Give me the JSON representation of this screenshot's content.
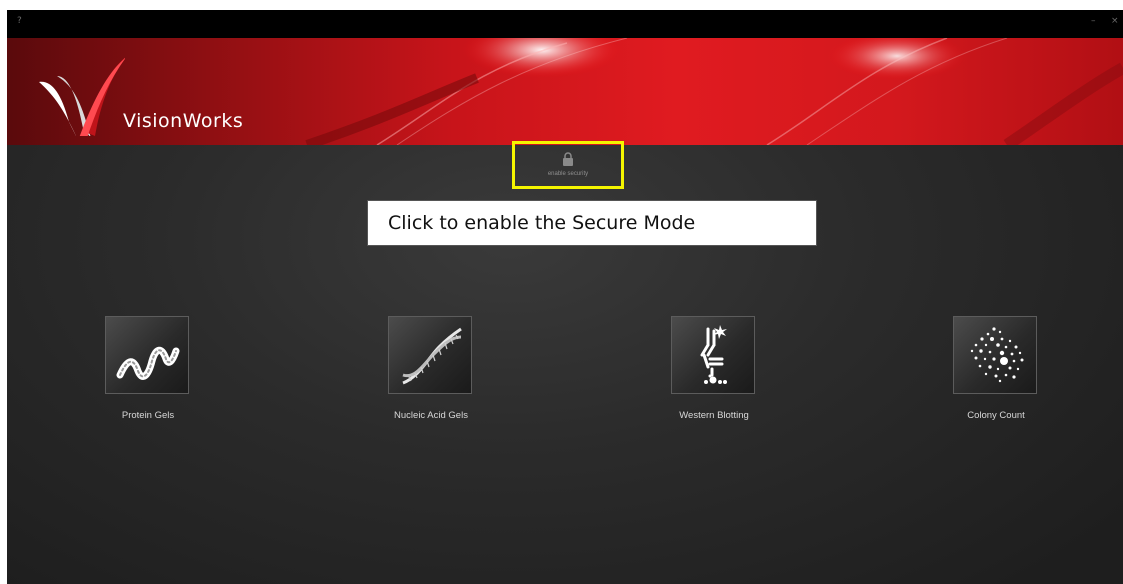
{
  "titlebar": {
    "help_label": "?",
    "minimize_label": "–",
    "close_label": "×"
  },
  "brand": {
    "name": "VisionWorks"
  },
  "security": {
    "label": "enable security",
    "highlight_color": "#f5f500"
  },
  "callout": {
    "text": "Click to enable the Secure Mode"
  },
  "modules": [
    {
      "label": "Protein Gels",
      "icon": "protein-wave-icon"
    },
    {
      "label": "Nucleic Acid Gels",
      "icon": "dna-helix-icon"
    },
    {
      "label": "Western Blotting",
      "icon": "antibody-icon"
    },
    {
      "label": "Colony Count",
      "icon": "colony-dots-icon"
    }
  ],
  "colors": {
    "banner_red": "#e01b20",
    "background": "#2b2b2b",
    "text": "#d8d8d8"
  }
}
